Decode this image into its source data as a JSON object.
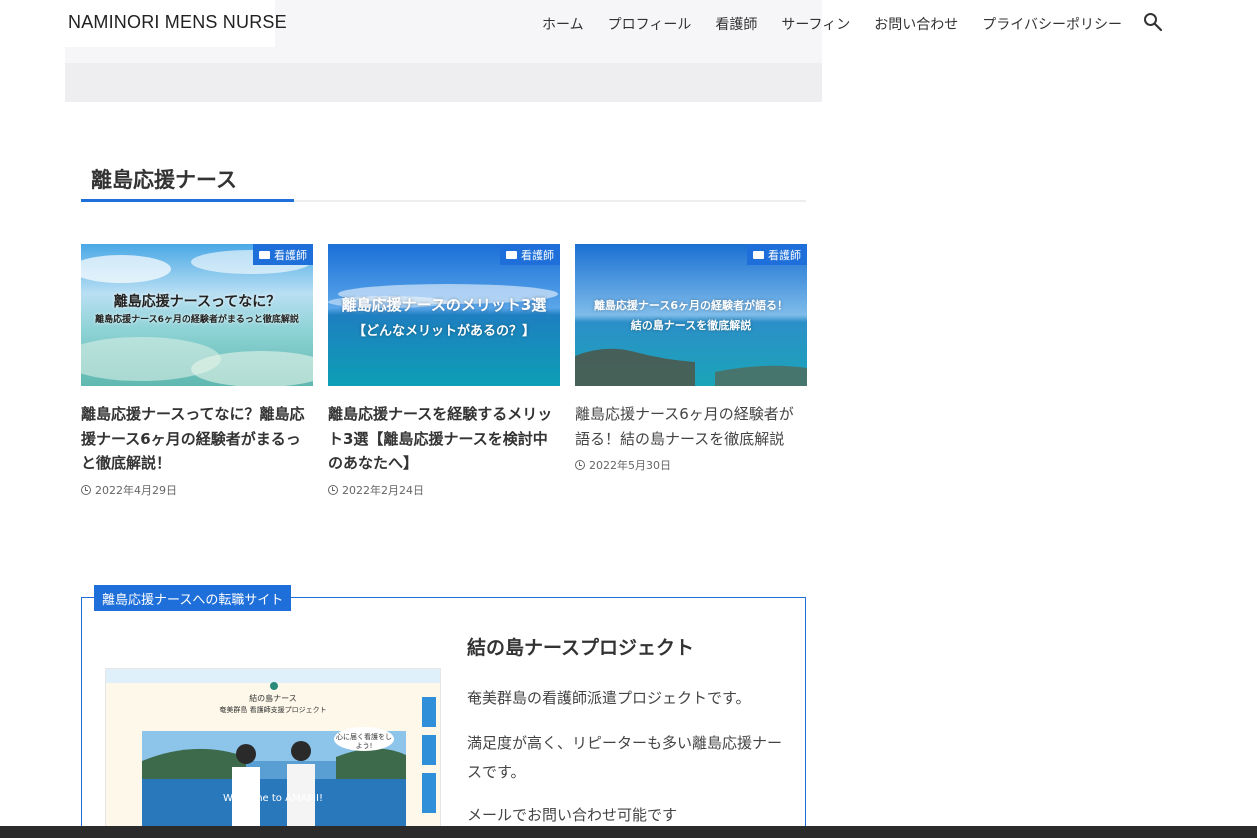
{
  "site": {
    "logo": "NAMINORI MENS NURSE"
  },
  "nav": {
    "items": [
      "ホーム",
      "プロフィール",
      "看護師",
      "サーフィン",
      "お問い合わせ",
      "プライバシーポリシー"
    ],
    "search_icon": "search-icon"
  },
  "section": {
    "title": "離島応援ナース"
  },
  "cards": [
    {
      "category": "看護師",
      "thumb_line1": "離島応援ナースってなに？",
      "thumb_line2": "離島応援ナース6ヶ月の経験者がまるっと徹底解説",
      "title": "離島応援ナースってなに？離島応援ナース6ヶ月の経験者がまるっと徹底解説！",
      "date": "2022年4月29日"
    },
    {
      "category": "看護師",
      "thumb_line1": "離島応援ナースのメリット3選",
      "thumb_line2": "【どんなメリットがあるの？】",
      "title": "離島応援ナースを経験するメリット3選【離島応援ナースを検討中のあなたへ】",
      "date": "2022年2月24日"
    },
    {
      "category": "看護師",
      "thumb_line1": "離島応援ナース6ヶ月の経験者が語る！",
      "thumb_line2": "結の島ナースを徹底解説",
      "title": "離島応援ナース6ヶ月の経験者が語る！結の島ナースを徹底解説",
      "date": "2022年5月30日"
    }
  ],
  "box": {
    "label": "離島応援ナースへの転職サイト",
    "heading": "結の島ナースプロジェクト",
    "paragraphs": [
      "奄美群島の看護師派遣プロジェクトです。",
      "満足度が高く、リピーターも多い離島応援ナースです。",
      "メールでお問い合わせ可能です"
    ],
    "thumb": {
      "title": "結の島ナース",
      "subtitle": "奄美群島 看護師支援プロジェクト",
      "bubble": "心に届く看護をしよう!",
      "welcome": "Welcome to AMAMI!"
    }
  },
  "colors": {
    "accent": "#1e6fd9",
    "taskbar": "#2b2b2b"
  }
}
